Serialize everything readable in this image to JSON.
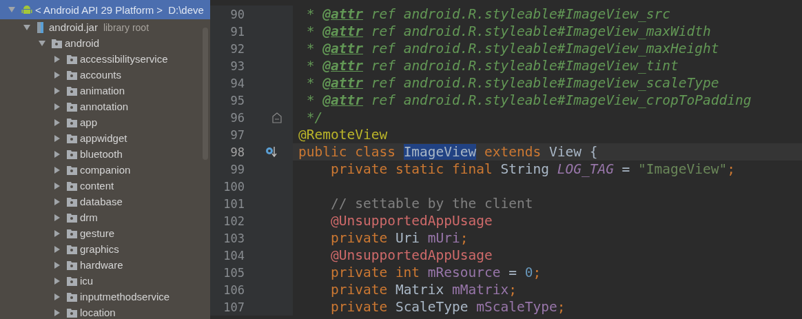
{
  "project_tree": {
    "items": [
      {
        "label": "< Android API 29 Platform >",
        "suffix": "D:\\deve",
        "kind": "platform",
        "expanded": true,
        "selected": true,
        "children": [
          {
            "label": "android.jar",
            "suffix": "library root",
            "kind": "jar",
            "expanded": true,
            "selected": false,
            "children": [
              {
                "label": "android",
                "kind": "package",
                "expanded": true,
                "selected": false,
                "children": [
                  {
                    "label": "accessibilityservice",
                    "kind": "package",
                    "expanded": false,
                    "selected": false
                  },
                  {
                    "label": "accounts",
                    "kind": "package",
                    "expanded": false,
                    "selected": false
                  },
                  {
                    "label": "animation",
                    "kind": "package",
                    "expanded": false,
                    "selected": false
                  },
                  {
                    "label": "annotation",
                    "kind": "package",
                    "expanded": false,
                    "selected": false
                  },
                  {
                    "label": "app",
                    "kind": "package",
                    "expanded": false,
                    "selected": false
                  },
                  {
                    "label": "appwidget",
                    "kind": "package",
                    "expanded": false,
                    "selected": false
                  },
                  {
                    "label": "bluetooth",
                    "kind": "package",
                    "expanded": false,
                    "selected": false
                  },
                  {
                    "label": "companion",
                    "kind": "package",
                    "expanded": false,
                    "selected": false
                  },
                  {
                    "label": "content",
                    "kind": "package",
                    "expanded": false,
                    "selected": false
                  },
                  {
                    "label": "database",
                    "kind": "package",
                    "expanded": false,
                    "selected": false
                  },
                  {
                    "label": "drm",
                    "kind": "package",
                    "expanded": false,
                    "selected": false
                  },
                  {
                    "label": "gesture",
                    "kind": "package",
                    "expanded": false,
                    "selected": false
                  },
                  {
                    "label": "graphics",
                    "kind": "package",
                    "expanded": false,
                    "selected": false
                  },
                  {
                    "label": "hardware",
                    "kind": "package",
                    "expanded": false,
                    "selected": false
                  },
                  {
                    "label": "icu",
                    "kind": "package",
                    "expanded": false,
                    "selected": false
                  },
                  {
                    "label": "inputmethodservice",
                    "kind": "package",
                    "expanded": false,
                    "selected": false
                  },
                  {
                    "label": "location",
                    "kind": "package",
                    "expanded": false,
                    "selected": false
                  }
                ]
              }
            ]
          }
        ]
      }
    ]
  },
  "editor": {
    "lines": [
      {
        "number": "90",
        "tokens": [
          {
            "kind": "comment",
            "text": " * "
          },
          {
            "kind": "doctag",
            "text": "@attr"
          },
          {
            "kind": "comment",
            "text": " ref android.R.styleable#ImageView_src"
          }
        ]
      },
      {
        "number": "91",
        "tokens": [
          {
            "kind": "comment",
            "text": " * "
          },
          {
            "kind": "doctag",
            "text": "@attr"
          },
          {
            "kind": "comment",
            "text": " ref android.R.styleable#ImageView_maxWidth"
          }
        ]
      },
      {
        "number": "92",
        "tokens": [
          {
            "kind": "comment",
            "text": " * "
          },
          {
            "kind": "doctag",
            "text": "@attr"
          },
          {
            "kind": "comment",
            "text": " ref android.R.styleable#ImageView_maxHeight"
          }
        ]
      },
      {
        "number": "93",
        "tokens": [
          {
            "kind": "comment",
            "text": " * "
          },
          {
            "kind": "doctag",
            "text": "@attr"
          },
          {
            "kind": "comment",
            "text": " ref android.R.styleable#ImageView_tint"
          }
        ]
      },
      {
        "number": "94",
        "tokens": [
          {
            "kind": "comment",
            "text": " * "
          },
          {
            "kind": "doctag",
            "text": "@attr"
          },
          {
            "kind": "comment",
            "text": " ref android.R.styleable#ImageView_scaleType"
          }
        ]
      },
      {
        "number": "95",
        "tokens": [
          {
            "kind": "comment",
            "text": " * "
          },
          {
            "kind": "doctag",
            "text": "@attr"
          },
          {
            "kind": "comment",
            "text": " ref android.R.styleable#ImageView_cropToPadding"
          }
        ]
      },
      {
        "number": "96",
        "fold": true,
        "tokens": [
          {
            "kind": "comment",
            "text": " */"
          }
        ]
      },
      {
        "number": "97",
        "tokens": [
          {
            "kind": "annotation",
            "text": "@RemoteView"
          }
        ]
      },
      {
        "number": "98",
        "current": true,
        "marker": true,
        "tokens": [
          {
            "kind": "keyword",
            "text": "public class "
          },
          {
            "kind": "selection",
            "text": "ImageView"
          },
          {
            "kind": "keyword",
            "text": " extends "
          },
          {
            "kind": "plain",
            "text": "View {"
          }
        ]
      },
      {
        "number": "99",
        "tokens": [
          {
            "kind": "keyword",
            "text": "    private static final "
          },
          {
            "kind": "plain",
            "text": "String "
          },
          {
            "kind": "constant",
            "text": "LOG_TAG"
          },
          {
            "kind": "plain",
            "text": " = "
          },
          {
            "kind": "string",
            "text": "\"ImageView\""
          },
          {
            "kind": "keyword",
            "text": ";"
          }
        ]
      },
      {
        "number": "100"
      },
      {
        "number": "101",
        "tokens": [
          {
            "kind": "linecomment",
            "text": "    // settable by the client"
          }
        ]
      },
      {
        "number": "102",
        "tokens": [
          {
            "kind": "unresolved",
            "text": "    @UnsupportedAppUsage"
          }
        ]
      },
      {
        "number": "103",
        "tokens": [
          {
            "kind": "keyword",
            "text": "    private "
          },
          {
            "kind": "plain",
            "text": "Uri "
          },
          {
            "kind": "field",
            "text": "mUri"
          },
          {
            "kind": "keyword",
            "text": ";"
          }
        ]
      },
      {
        "number": "104",
        "tokens": [
          {
            "kind": "unresolved",
            "text": "    @UnsupportedAppUsage"
          }
        ]
      },
      {
        "number": "105",
        "tokens": [
          {
            "kind": "keyword",
            "text": "    private int "
          },
          {
            "kind": "field",
            "text": "mResource"
          },
          {
            "kind": "plain",
            "text": " = "
          },
          {
            "kind": "number",
            "text": "0"
          },
          {
            "kind": "keyword",
            "text": ";"
          }
        ]
      },
      {
        "number": "106",
        "tokens": [
          {
            "kind": "keyword",
            "text": "    private "
          },
          {
            "kind": "plain",
            "text": "Matrix "
          },
          {
            "kind": "field",
            "text": "mMatrix"
          },
          {
            "kind": "keyword",
            "text": ";"
          }
        ]
      },
      {
        "number": "107",
        "tokens": [
          {
            "kind": "keyword",
            "text": "    private "
          },
          {
            "kind": "plain",
            "text": "ScaleType "
          },
          {
            "kind": "field",
            "text": "mScaleType"
          },
          {
            "kind": "keyword",
            "text": ";"
          }
        ]
      }
    ]
  }
}
